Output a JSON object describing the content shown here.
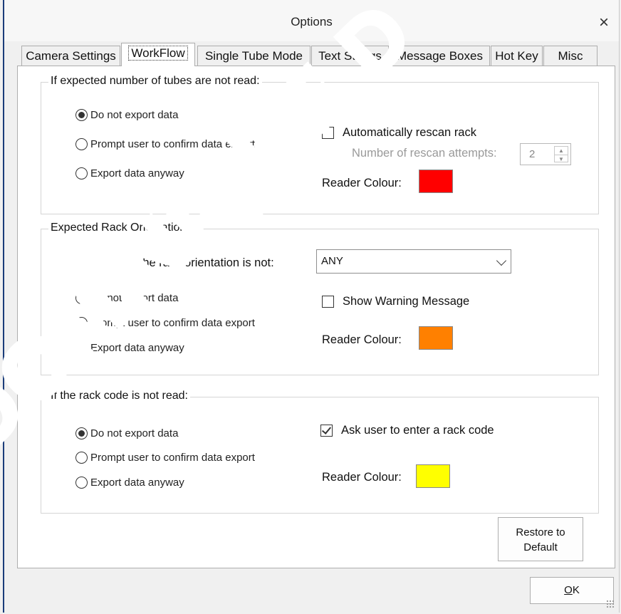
{
  "window": {
    "title": "Options",
    "close_glyph": "×"
  },
  "tabs": [
    {
      "label": "Camera Settings"
    },
    {
      "label": "WorkFlow",
      "active": true
    },
    {
      "label": "Single Tube Mode"
    },
    {
      "label": "Text Strings"
    },
    {
      "label": "Message Boxes"
    },
    {
      "label": "Hot Key"
    },
    {
      "label": "Misc"
    }
  ],
  "group1": {
    "legend": "If expected number of tubes are not read:",
    "options": [
      "Do not export data",
      "Prompt user to confirm data export",
      "Export data anyway"
    ],
    "selected_index": 0,
    "auto_rescan_label": "Automatically rescan rack",
    "auto_rescan_checked": false,
    "rescan_attempts_label": "Number of rescan attempts:",
    "rescan_attempts_value": "2",
    "reader_colour_label": "Reader Colour:",
    "reader_colour": "#ff0000"
  },
  "group2": {
    "legend": "Expected Rack Orientation",
    "orientation_label": "If the rack orientation is not:",
    "orientation_value": "ANY",
    "options": [
      "Do not export data",
      "Prompt user to confirm data export",
      "Export data anyway"
    ],
    "selected_index": 0,
    "show_warning_label": "Show Warning Message",
    "show_warning_checked": false,
    "reader_colour_label": "Reader Colour:",
    "reader_colour": "#ff8000"
  },
  "group3": {
    "legend": "If the rack code is not read:",
    "options": [
      "Do not export data",
      "Prompt user to confirm data export",
      "Export data anyway"
    ],
    "selected_index": 0,
    "ask_code_label": "Ask user to enter a rack code",
    "ask_code_checked": true,
    "reader_colour_label": "Reader Colour:",
    "reader_colour": "#ffff00"
  },
  "buttons": {
    "restore_line1": "Restore to",
    "restore_line2": "Default",
    "ok_prefix": "O",
    "ok_rest": "K"
  },
  "watermark": {
    "text": "DOMINIQUE D",
    "color": "#ffffff"
  }
}
